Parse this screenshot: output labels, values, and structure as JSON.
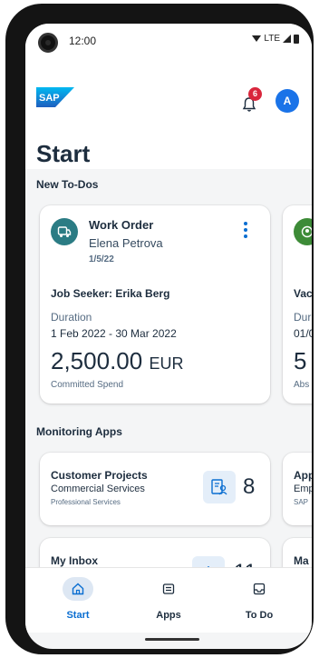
{
  "status_bar": {
    "time": "12:00",
    "network": "LTE"
  },
  "header": {
    "logo": "SAP",
    "notifications_count": "6",
    "avatar_initial": "A",
    "title": "Start"
  },
  "new_todos": {
    "section_title": "New To-Dos",
    "cards": [
      {
        "type": "Work Order",
        "person": "Elena Petrova",
        "date": "1/5/22",
        "subject": "Job Seeker: Erika Berg",
        "duration_label": "Duration",
        "duration_value": "1 Feb 2022 - 30 Mar 2022",
        "amount": "2,500.00",
        "currency": "EUR",
        "footer": "Committed Spend",
        "icon": "truck-icon",
        "icon_color": "#2b7c84"
      },
      {
        "subject": "Vac",
        "duration_label": "Dur",
        "duration_value": "01/0",
        "amount": "5",
        "footer": "Abs",
        "icon": "person-icon",
        "icon_color": "#3d8b37"
      }
    ]
  },
  "monitoring": {
    "section_title": "Monitoring Apps",
    "cards": [
      {
        "title": "Customer Projects",
        "subtitle": "Commercial Services",
        "sub2": "Professional Services",
        "count": "8",
        "icon": "project-icon"
      },
      {
        "title": "App",
        "subtitle": "Emp",
        "sub2": "SAP"
      },
      {
        "title": "My Inbox",
        "count": "11",
        "icon": "download-icon"
      },
      {
        "title": "Ma"
      }
    ]
  },
  "bottom_nav": {
    "items": [
      {
        "label": "Start",
        "icon": "home-icon",
        "active": true
      },
      {
        "label": "Apps",
        "icon": "apps-icon",
        "active": false
      },
      {
        "label": "To Do",
        "icon": "inbox-icon",
        "active": false
      }
    ]
  },
  "colors": {
    "accent": "#0a6ed1",
    "badge": "#d9263c",
    "avatar": "#1a73e8"
  }
}
